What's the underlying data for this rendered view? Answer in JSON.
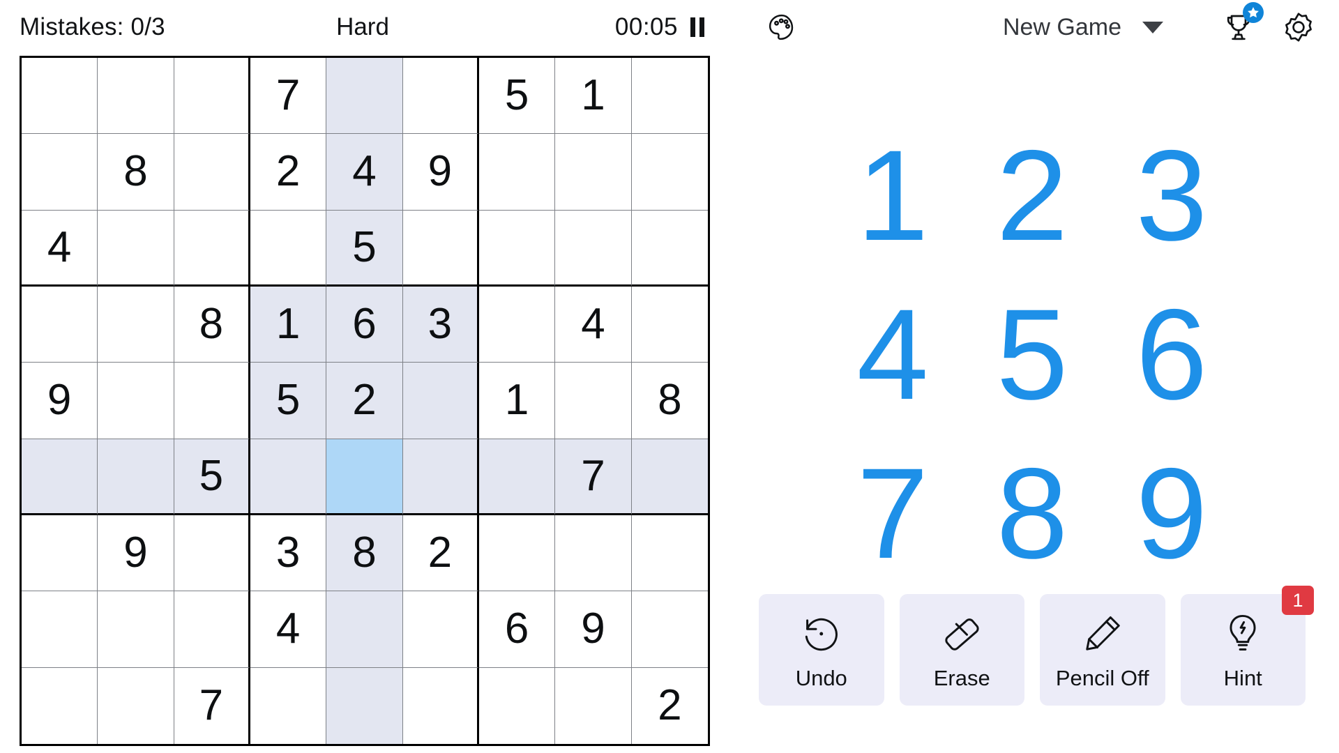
{
  "status": {
    "mistakes_label": "Mistakes: 0/3",
    "difficulty": "Hard",
    "timer": "00:05",
    "pause_icon": "pause-icon"
  },
  "toolbar": {
    "palette_icon": "palette-icon",
    "new_game_label": "New Game",
    "dropdown_icon": "chevron-down-icon",
    "trophy_icon": "trophy-icon",
    "trophy_badge_icon": "star-icon",
    "settings_icon": "gear-icon"
  },
  "numpad": {
    "numbers": [
      "1",
      "2",
      "3",
      "4",
      "5",
      "6",
      "7",
      "8",
      "9"
    ],
    "color": "#1e90e8"
  },
  "actions": [
    {
      "id": "undo",
      "label": "Undo",
      "icon": "undo-icon",
      "badge": null
    },
    {
      "id": "erase",
      "label": "Erase",
      "icon": "eraser-icon",
      "badge": null
    },
    {
      "id": "pencil",
      "label": "Pencil Off",
      "icon": "pencil-icon",
      "badge": null
    },
    {
      "id": "hint",
      "label": "Hint",
      "icon": "lightbulb-icon",
      "badge": "1"
    }
  ],
  "board": {
    "selected": {
      "row": 6,
      "col": 5
    },
    "highlight_color": "#e3e6f1",
    "selected_color": "#aed7f7",
    "rows": [
      [
        "",
        "",
        "",
        "7",
        "",
        "",
        "5",
        "1",
        ""
      ],
      [
        "",
        "8",
        "",
        "2",
        "4",
        "9",
        "",
        "",
        ""
      ],
      [
        "4",
        "",
        "",
        "",
        "5",
        "",
        "",
        "",
        ""
      ],
      [
        "",
        "",
        "8",
        "1",
        "6",
        "3",
        "",
        "4",
        ""
      ],
      [
        "9",
        "",
        "",
        "5",
        "2",
        "",
        "1",
        "",
        "8"
      ],
      [
        "",
        "",
        "5",
        "",
        "",
        "",
        "",
        "7",
        ""
      ],
      [
        "",
        "9",
        "",
        "3",
        "8",
        "2",
        "",
        "",
        ""
      ],
      [
        "",
        "",
        "",
        "4",
        "",
        "",
        "6",
        "9",
        ""
      ],
      [
        "",
        "",
        "7",
        "",
        "",
        "",
        "",
        "",
        "2"
      ]
    ]
  }
}
